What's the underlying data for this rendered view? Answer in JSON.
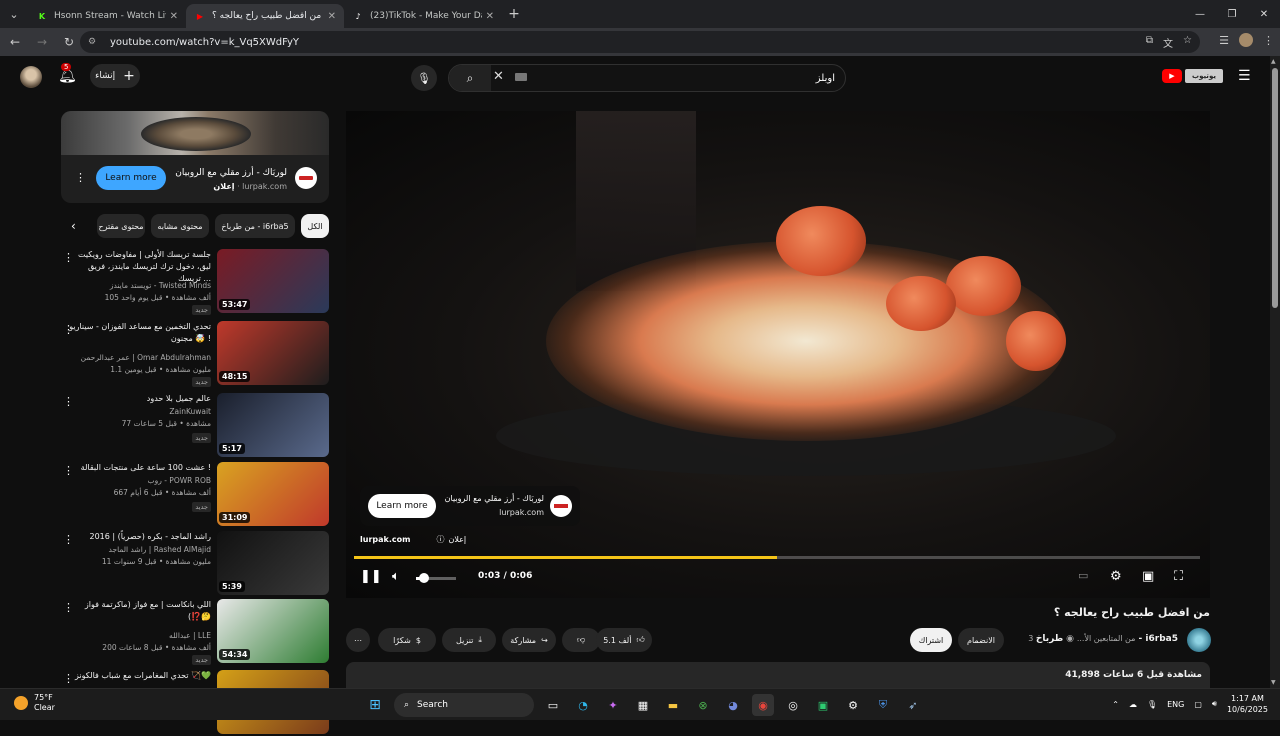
{
  "browser": {
    "tabs": [
      {
        "title": "Hsonn Stream - Watch Live on K",
        "favicon": "K",
        "favicon_color": "#53fc18",
        "active": false
      },
      {
        "title": "من افضل طبيب راح يعالجه ؟",
        "favicon": "▶",
        "favicon_color": "#ff0000",
        "active": true
      },
      {
        "title": "(23)TikTok - Make Your Day",
        "favicon": "♪",
        "favicon_color": "#ffffff",
        "active": false
      }
    ],
    "new_tab_label": "+",
    "url": "youtube.com/watch?v=k_Vq5XWdFyY"
  },
  "yt": {
    "notif_count": "5",
    "create_label": "إنشاء",
    "search_value": "اوبلز",
    "ad_card": {
      "title": "لوربَاك - أرز مقلي مع الروبيان",
      "sponsor_label": "إعلان",
      "domain": "lurpak.com",
      "cta": "Learn more"
    },
    "chips": [
      {
        "label": "الكل",
        "selected": true
      },
      {
        "label": "من طرباخ - i6rba5",
        "selected": false
      },
      {
        "label": "محتوى مشابه",
        "selected": false
      },
      {
        "label": "محتوى مقترح",
        "selected": false
      }
    ],
    "related": [
      {
        "title": "جلسة تريسك الأولى | مفاوضات رويكيت ليق، دخول ترك لتريسك مايندز، فريق تريسك ...",
        "channel": "تويستد مايندز - Twisted Minds",
        "meta": "105 ألف مشاهدة • قبل يوم واحد",
        "badge": "جديد",
        "duration": "53:47",
        "colors": [
          "#7a1b24",
          "#2a3a5a"
        ]
      },
      {
        "title": "تحدي التخمين مع مساعد الفوزان - سيناريو مجنون 🤯 !",
        "channel": "عمر عبدالرحمن | Omar Abdulrahman",
        "meta": "1.1 مليون مشاهدة • قبل يومين",
        "badge": "جديد",
        "duration": "48:15",
        "colors": [
          "#c0392b",
          "#1d1d1d"
        ]
      },
      {
        "title": "عالم جميل بلا حدود",
        "channel": "ZainKuwait",
        "meta": "77 مشاهدة • قبل 5 ساعات",
        "badge": "جديد",
        "duration": "5:17",
        "colors": [
          "#1a1f2c",
          "#5a6a8c"
        ]
      },
      {
        "title": "عشت 100 ساعة على منتجات البقالة !",
        "channel": "روب - POWR ROB",
        "meta": "667 ألف مشاهدة • قبل 6 أيام",
        "badge": "جديد",
        "duration": "31:09",
        "colors": [
          "#d9a321",
          "#c0392b"
        ]
      },
      {
        "title": "راشد الماجد - بكره (حصرياً) | 2016",
        "channel": "راشد الماجد | Rashed AlMajid",
        "meta": "11 مليون مشاهدة • قبل 9 سنوات",
        "badge": "",
        "duration": "5:39",
        "colors": [
          "#111111",
          "#3a3a3a"
        ]
      },
      {
        "title": "اللي بانكاست | مع فواز (ماكرتمة فواز 🤔⁉️)",
        "channel": "عبدالله | LLE",
        "meta": "200 ألف مشاهدة • قبل 8 ساعات",
        "badge": "جديد",
        "duration": "54:34",
        "colors": [
          "#e8e8e8",
          "#2e7d32"
        ]
      },
      {
        "title": "تحدي المغامرات مع شباب فالكونز 🏹💚",
        "channel": "",
        "meta": "",
        "badge": "",
        "duration": "",
        "colors": [
          "#d4a017",
          "#7a3b1b"
        ]
      }
    ],
    "player": {
      "overlay_ad_title": "لوربَاك - أرز مقلي مع الروبيان",
      "overlay_ad_domain": "lurpak.com",
      "overlay_cta": "Learn more",
      "ad_domain": "lurpak.com",
      "ad_label": "إعلان",
      "time": "0:03 / 0:06",
      "progress": 0.5,
      "volume": 0.2,
      "accent": "#f5c518"
    },
    "video_title": "من افضل طبيب راح يعالجه ؟",
    "channel": {
      "name": "طرباخ - i6rba5",
      "subs_text": "3 من المتابعين الأ...",
      "join_label": "الانضمام",
      "subscribe_label": "اشتراك"
    },
    "actions": {
      "likes": "5.1 ألف",
      "share": "مشاركة",
      "download": "تنزيل",
      "thanks": "شكرًا"
    },
    "description": {
      "views": "41,898 مشاهدة قبل 6 ساعات"
    }
  },
  "taskbar": {
    "temp": "75°F",
    "weather": "Clear",
    "search_label": "Search",
    "lang": "ENG",
    "time": "1:17 AM",
    "date": "10/6/2025"
  }
}
